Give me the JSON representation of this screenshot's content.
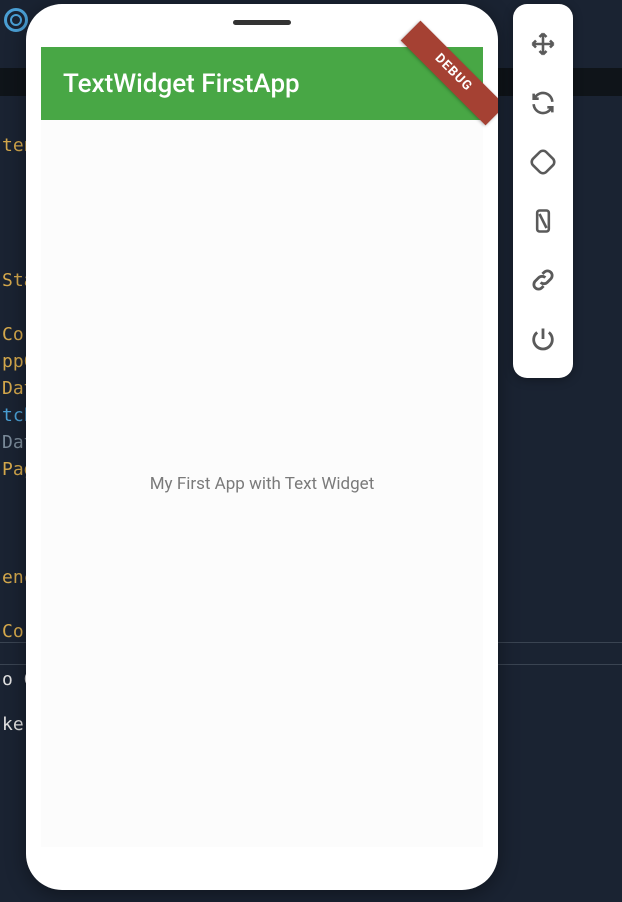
{
  "editor": {
    "code_fragments": [
      "ten",
      "Sta",
      "Cor",
      "ppC",
      "Dat",
      "tch",
      "Dat",
      "Pag",
      "enc",
      "Cor"
    ],
    "bottom_tab": "o Co",
    "bottom_text": "ker"
  },
  "app": {
    "title": "TextWidget FirstApp",
    "body_text": "My First App with Text Widget",
    "debug_label": "DEBUG"
  },
  "toolbar": {
    "items": [
      {
        "name": "move",
        "label": "Move"
      },
      {
        "name": "reload",
        "label": "Hot Reload"
      },
      {
        "name": "rotate",
        "label": "Rotate"
      },
      {
        "name": "resize",
        "label": "Resize"
      },
      {
        "name": "link",
        "label": "Link"
      },
      {
        "name": "power",
        "label": "Power"
      }
    ]
  },
  "colors": {
    "app_bar": "#48a745",
    "debug_ribbon": "#a54133",
    "background": "#1a2332"
  }
}
